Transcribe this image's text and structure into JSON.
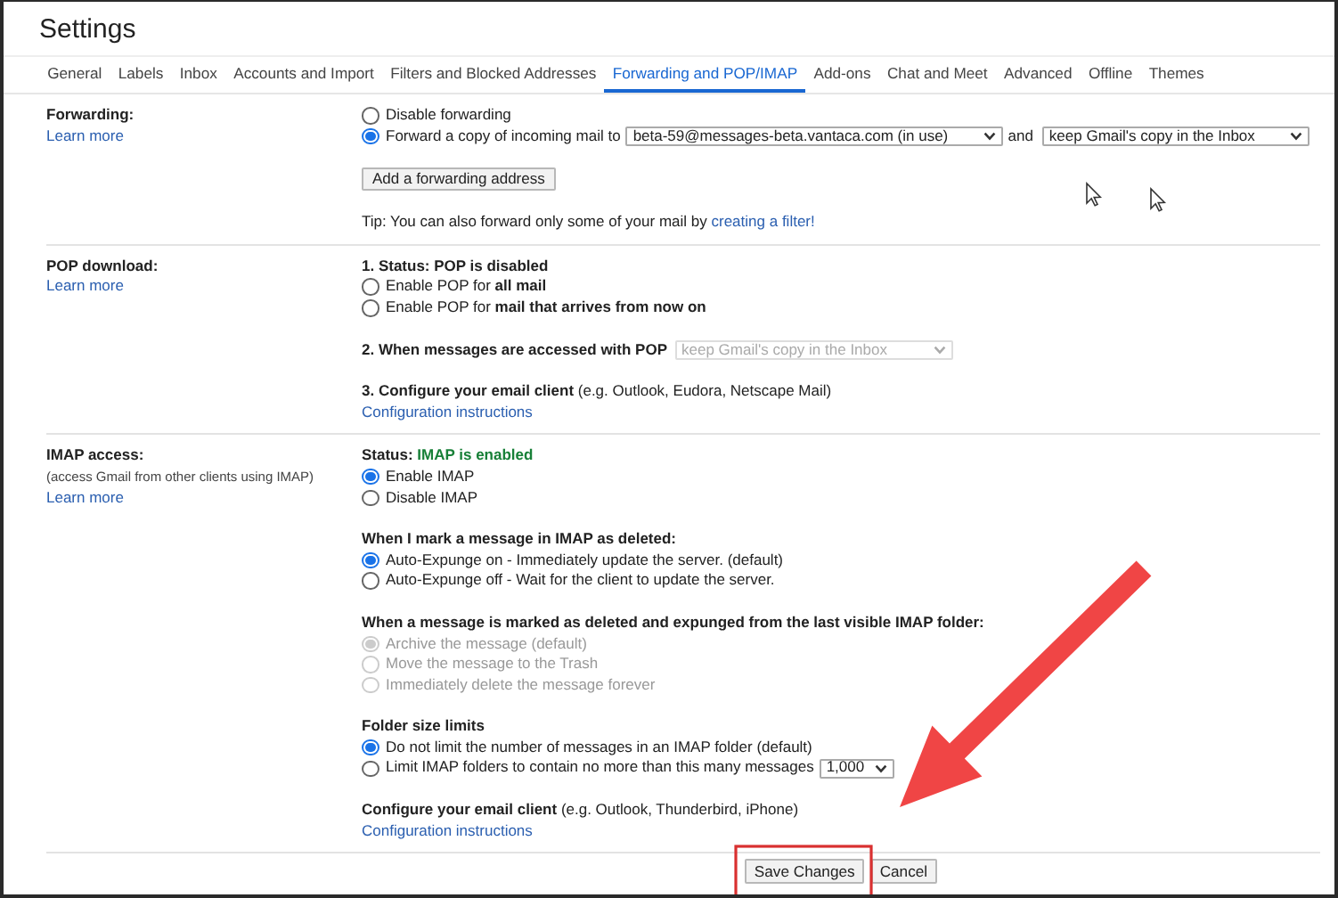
{
  "window": {
    "title": "Settings"
  },
  "tabs": [
    {
      "label": "General",
      "selected": false
    },
    {
      "label": "Labels",
      "selected": false
    },
    {
      "label": "Inbox",
      "selected": false
    },
    {
      "label": "Accounts and Import",
      "selected": false
    },
    {
      "label": "Filters and Blocked Addresses",
      "selected": false
    },
    {
      "label": "Forwarding and POP/IMAP",
      "selected": true
    },
    {
      "label": "Add-ons",
      "selected": false
    },
    {
      "label": "Chat and Meet",
      "selected": false
    },
    {
      "label": "Advanced",
      "selected": false
    },
    {
      "label": "Offline",
      "selected": false
    },
    {
      "label": "Themes",
      "selected": false
    }
  ],
  "sections": [
    {
      "label": "Forwarding:",
      "link": "Learn more",
      "groups": [
        [
          {
            "kind": "radio",
            "label": "Disable forwarding",
            "selected": false,
            "disabled": false
          },
          {
            "kind": "radio",
            "label": "Forward a copy of incoming mail to",
            "selected": true,
            "disabled": false,
            "controls": [
              {
                "kind": "select",
                "value": "beta-59@messages-beta.vantaca.com (in use)",
                "disabled": false
              },
              {
                "kind": "text",
                "text": "and"
              },
              {
                "kind": "select",
                "value": "keep Gmail's copy in the Inbox",
                "disabled": false
              }
            ]
          }
        ],
        [
          {
            "kind": "button",
            "label": "Add a forwarding address"
          }
        ],
        [
          {
            "kind": "text",
            "text": "Tip: You can also forward only some of your mail by",
            "link": "creating a filter!"
          }
        ]
      ]
    },
    {
      "label": "POP download:",
      "link": "Learn more",
      "groups": [
        [
          {
            "kind": "status",
            "label": "1. Status:",
            "value": "POP is disabled",
            "color": "#222222"
          },
          {
            "kind": "radio",
            "label": "Enable POP for **all mail**",
            "selected": false,
            "disabled": false
          },
          {
            "kind": "radio",
            "label": "Enable POP for **mail that arrives from now on**",
            "selected": false,
            "disabled": false
          }
        ],
        [
          {
            "kind": "select-row",
            "label": "2. When messages are accessed with POP",
            "value": "keep Gmail's copy in the Inbox",
            "disabled": true
          }
        ],
        [
          {
            "kind": "text",
            "text": "**3. Configure your email client** (e.g. Outlook, Eudora, Netscape Mail)"
          },
          {
            "kind": "link",
            "text": "Configuration instructions"
          }
        ]
      ]
    },
    {
      "label": "IMAP access:",
      "note": "(access Gmail from other clients using IMAP)",
      "link": "Learn more",
      "groups": [
        [
          {
            "kind": "status",
            "label": "Status:",
            "value": "IMAP is enabled",
            "color": "#188038"
          },
          {
            "kind": "radio",
            "label": "Enable IMAP",
            "selected": true,
            "disabled": false
          },
          {
            "kind": "radio",
            "label": "Disable IMAP",
            "selected": false,
            "disabled": false
          }
        ],
        [
          {
            "kind": "heading",
            "text": "When I mark a message in IMAP as deleted:"
          },
          {
            "kind": "radio",
            "label": "Auto-Expunge on - Immediately update the server. (default)",
            "selected": true,
            "disabled": false
          },
          {
            "kind": "radio",
            "label": "Auto-Expunge off - Wait for the client to update the server.",
            "selected": false,
            "disabled": false
          }
        ],
        [
          {
            "kind": "heading",
            "text": "When a message is marked as deleted and expunged from the last visible IMAP folder:"
          },
          {
            "kind": "radio",
            "label": "Archive the message (default)",
            "selected": true,
            "disabled": true
          },
          {
            "kind": "radio",
            "label": "Move the message to the Trash",
            "selected": false,
            "disabled": true
          },
          {
            "kind": "radio",
            "label": "Immediately delete the message forever",
            "selected": false,
            "disabled": true
          }
        ],
        [
          {
            "kind": "heading",
            "text": "Folder size limits"
          },
          {
            "kind": "radio",
            "label": "Do not limit the number of messages in an IMAP folder (default)",
            "selected": true,
            "disabled": false
          },
          {
            "kind": "radio",
            "label": "Limit IMAP folders to contain no more than this many messages",
            "selected": false,
            "disabled": false,
            "controls": [
              {
                "kind": "select",
                "value": "1,000",
                "disabled": false
              }
            ]
          }
        ],
        [
          {
            "kind": "text",
            "text": "**Configure your email client** (e.g. Outlook, Thunderbird, iPhone)"
          },
          {
            "kind": "link",
            "text": "Configuration instructions"
          }
        ]
      ]
    }
  ],
  "actions": [
    {
      "label": "Save Changes"
    },
    {
      "label": "Cancel"
    }
  ]
}
